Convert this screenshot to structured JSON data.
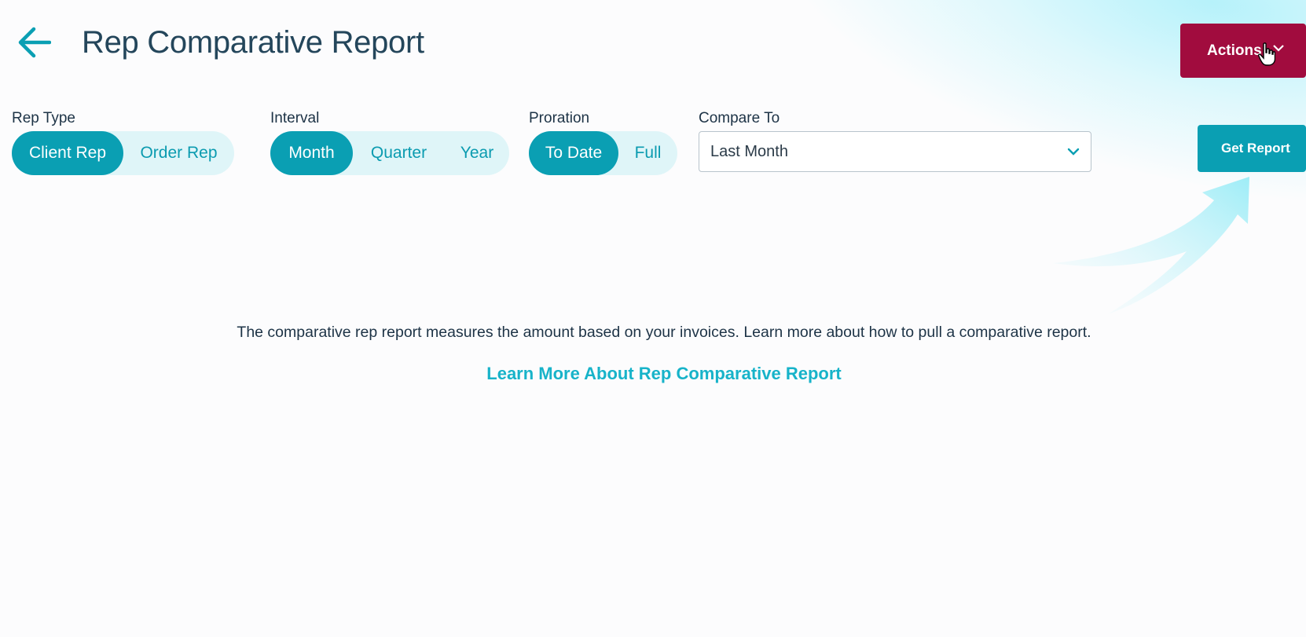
{
  "header": {
    "title": "Rep Comparative Report",
    "back_icon": "arrow-left-icon"
  },
  "actions": {
    "label": "Actions",
    "color": "#a10c3e"
  },
  "filters": {
    "rep_type": {
      "label": "Rep Type",
      "options": [
        "Client Rep",
        "Order Rep"
      ],
      "selected": "Client Rep"
    },
    "interval": {
      "label": "Interval",
      "options": [
        "Month",
        "Quarter",
        "Year"
      ],
      "selected": "Month"
    },
    "proration": {
      "label": "Proration",
      "options": [
        "To Date",
        "Full"
      ],
      "selected": "To Date"
    },
    "compare_to": {
      "label": "Compare To",
      "value": "Last Month"
    }
  },
  "get_report": {
    "label": "Get Report",
    "color": "#0a9fb3"
  },
  "info": {
    "text": "The comparative rep report measures the amount based on your invoices. Learn more about how to pull a comparative report.",
    "link_label": "Learn More About Rep Comparative Report"
  },
  "theme": {
    "accent": "#0a9fb3",
    "link": "#17b3c9",
    "segment_bg": "#dff5f8"
  }
}
